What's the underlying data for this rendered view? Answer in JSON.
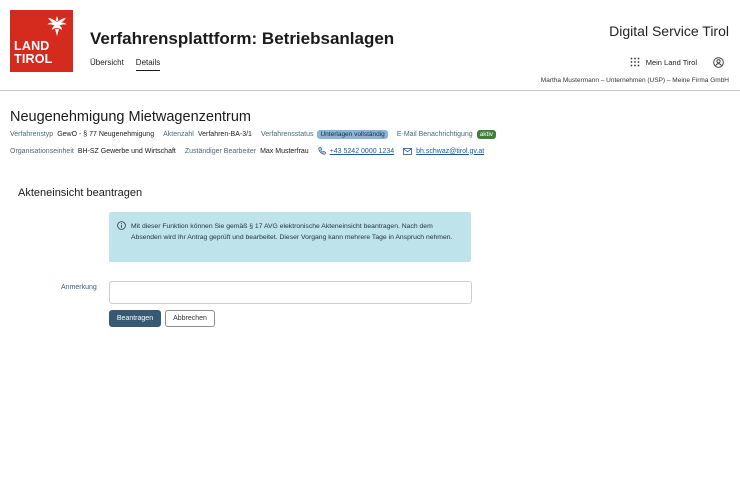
{
  "header": {
    "logo_line1": "LAND",
    "logo_line2": "TIROL",
    "app_title": "Verfahrensplattform: Betriebsanlagen",
    "nav_tabs": [
      {
        "label": "Übersicht",
        "active": false
      },
      {
        "label": "Details",
        "active": true
      }
    ],
    "brand": "Digital Service Tirol",
    "user_menu_label": "Mein Land Tirol",
    "org_crumb": "Martha Mustermann – Unternehmen (USP) – Meine Firma GmbH",
    "logo_color": "#d52b1e"
  },
  "case": {
    "title": "Neugenehmigung Mietwagenzentrum",
    "type_label": "Verfahrenstyp",
    "type_value": "GewO - § 77 Neugenehmigung",
    "file_label": "Aktenzahl",
    "file_value": "Verfahren-BA-3/1",
    "status_label": "Verfahrensstatus",
    "status_value": "Unterlagen vollständig",
    "email_notify_label": "E-Mail Benachrichtigung",
    "email_notify_value": "aktiv",
    "org_label": "Organisationseinheit",
    "org_value": "BH-SZ Gewerbe und Wirtschaft",
    "clerk_label": "Zuständiger Bearbeiter",
    "clerk_value": "Max Musterfrau",
    "phone": "+43 5242 0000 1234",
    "email": "bh.schwaz@tirol.gv.at"
  },
  "form": {
    "section_title": "Akteneinsicht beantragen",
    "info_text": "Mit dieser Funktion können Sie gemäß § 17 AVG elektronische Akteneinsicht beantragen. Nach dem Absenden wird Ihr Antrag geprüft und bearbeitet. Dieser Vorgang kann mehrere Tage in Anspruch nehmen.",
    "note_label": "Anmerkung",
    "note_value": "",
    "note_placeholder": "",
    "submit_label": "Beantragen",
    "cancel_label": "Abbrechen"
  },
  "colors": {
    "status_badge": "#8ab4d8",
    "active_badge": "#3f7f3a",
    "info_box": "#bfe3ea",
    "primary_button": "#375a72",
    "link": "#1e5a99"
  },
  "icons": [
    "eagle-icon",
    "grid-icon",
    "account-icon",
    "phone-icon",
    "mail-icon",
    "info-icon"
  ]
}
